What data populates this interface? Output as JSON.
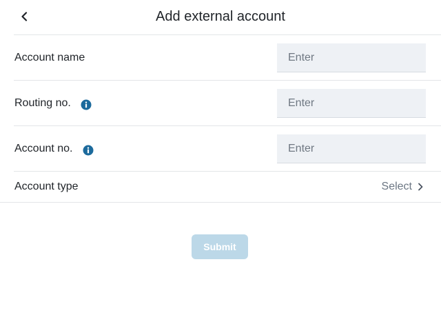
{
  "header": {
    "title": "Add external account",
    "back_icon": "chevron-left-icon"
  },
  "form": {
    "account_name": {
      "label": "Account name",
      "placeholder": "Enter"
    },
    "routing_no": {
      "label": "Routing no.",
      "placeholder": "Enter",
      "info_icon": "info-icon"
    },
    "account_no": {
      "label": "Account no.",
      "placeholder": "Enter",
      "info_icon": "info-icon"
    },
    "account_type": {
      "label": "Account type",
      "select_label": "Select",
      "chevron_icon": "chevron-right-icon"
    }
  },
  "submit": {
    "label": "Submit"
  },
  "colors": {
    "accent": "#1c6a9c",
    "input_bg": "#eef1f5",
    "submit_disabled_bg": "#bcd8e8",
    "divider": "#e3e5e8"
  }
}
